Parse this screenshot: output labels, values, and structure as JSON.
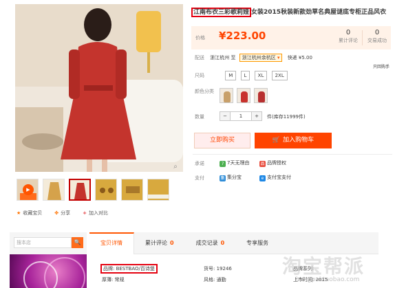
{
  "product": {
    "title_highlight": "江南布衣三彩歌莉娅",
    "title_rest": "女装2015秋装新款劲草名典屋谜底专柜正品风衣",
    "price_label": "价格",
    "price": "¥223.00",
    "stats": [
      {
        "value": "0",
        "label": "累计评论"
      },
      {
        "value": "0",
        "label": "交易成功"
      }
    ]
  },
  "delivery": {
    "label": "配送",
    "from": "浙江杭州 至",
    "to": "浙江杭州余杭区",
    "shipping": "快递 ¥5.00",
    "note": "只回购手"
  },
  "size": {
    "label": "尺码",
    "options": [
      "M",
      "L",
      "XL",
      "2XL"
    ]
  },
  "color": {
    "label": "颜色分类",
    "swatch_colors": [
      "#c8a06a",
      "#c8322d",
      "#b83030"
    ]
  },
  "quantity": {
    "label": "数量",
    "minus": "−",
    "value": "1",
    "plus": "+",
    "unit": "件(库存11999件)"
  },
  "buttons": {
    "buy_now": "立即购买",
    "add_cart": "加入购物车"
  },
  "promise": {
    "label": "承诺",
    "items": [
      {
        "icon": "7",
        "text": "7天无理由",
        "color": "#4caf50"
      },
      {
        "icon": "品",
        "text": "品牌授权",
        "color": "#e84c3d"
      }
    ]
  },
  "payment": {
    "label": "支付",
    "items": [
      {
        "icon": "集",
        "text": "集分宝",
        "color": "#2d8cd7"
      },
      {
        "icon": "e",
        "text": "支付宝支付",
        "color": "#1e88e5"
      }
    ]
  },
  "actions": {
    "favorite": "收藏宝贝",
    "share": "分享",
    "compare": "加入对比"
  },
  "shop": {
    "search_placeholder": "搜本店",
    "search_button": "🔍"
  },
  "tabs": [
    {
      "label": "宝贝详情",
      "count": ""
    },
    {
      "label": "累计评论",
      "count": "0"
    },
    {
      "label": "成交记录",
      "count": "0"
    },
    {
      "label": "专享服务",
      "count": ""
    }
  ],
  "attributes": [
    "品牌: BESTBAO/百诗堡",
    "货号: 19246",
    "厚薄: 常规",
    "风格: 通勤",
    "品牌系列:",
    "上市时间: 2015"
  ],
  "watermark": {
    "main": "淘宝帮派",
    "url": "bangpai.taobao.com"
  }
}
